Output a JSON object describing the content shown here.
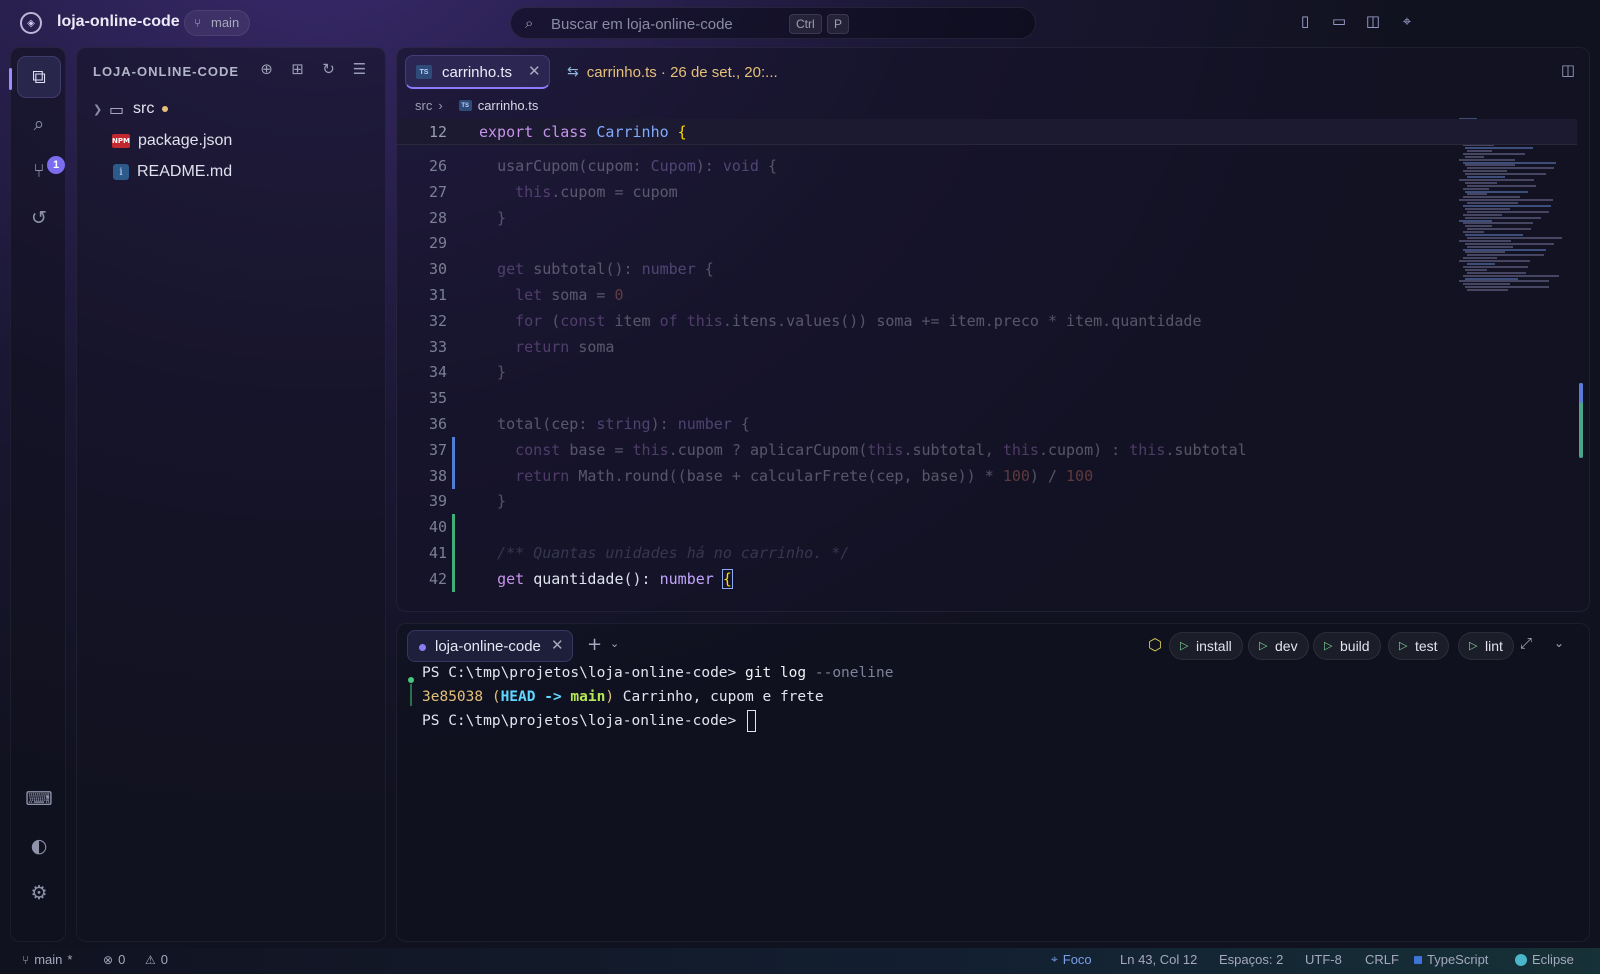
{
  "titlebar": {
    "project": "loja-online-code",
    "branch": "main",
    "search_placeholder": "Buscar em loja-online-code",
    "shortcut_ctrl": "Ctrl",
    "shortcut_p": "P"
  },
  "activity": {
    "scm_badge": "1"
  },
  "explorer": {
    "title": "LOJA-ONLINE-CODE",
    "items": [
      {
        "name": "src",
        "type": "folder",
        "modified": true
      },
      {
        "name": "package.json",
        "type": "npm"
      },
      {
        "name": "README.md",
        "type": "info"
      }
    ]
  },
  "editor": {
    "tab_label": "carrinho.ts",
    "tab_icon": "TS",
    "diff_tab_label": "carrinho.ts · 26 de set., 20:...",
    "breadcrumb_folder": "src",
    "breadcrumb_file": "carrinho.ts",
    "sticky_line": {
      "num": "12",
      "code": "export class Carrinho {"
    },
    "lines": [
      {
        "num": "26",
        "code": "  usarCupom(cupom: Cupom): void {"
      },
      {
        "num": "27",
        "code": "    this.cupom = cupom"
      },
      {
        "num": "28",
        "code": "  }"
      },
      {
        "num": "29",
        "code": ""
      },
      {
        "num": "30",
        "code": "  get subtotal(): number {"
      },
      {
        "num": "31",
        "code": "    let soma = 0"
      },
      {
        "num": "32",
        "code": "    for (const item of this.itens.values()) soma += item.preco * item.quantidade"
      },
      {
        "num": "33",
        "code": "    return soma"
      },
      {
        "num": "34",
        "code": "  }"
      },
      {
        "num": "35",
        "code": ""
      },
      {
        "num": "36",
        "code": "  total(cep: string): number {"
      },
      {
        "num": "37",
        "code": "    const base = this.cupom ? aplicarCupom(this.subtotal, this.cupom) : this.subtotal"
      },
      {
        "num": "38",
        "code": "    return Math.round((base + calcularFrete(cep, base)) * 100) / 100"
      },
      {
        "num": "39",
        "code": "  }"
      },
      {
        "num": "40",
        "code": ""
      },
      {
        "num": "41",
        "code": "  /** Quantas unidades há no carrinho. */"
      },
      {
        "num": "42",
        "code": "  get quantidade(): number {"
      }
    ]
  },
  "terminal": {
    "tab_label": "loja-online-code",
    "tasks": [
      "install",
      "dev",
      "build",
      "test",
      "lint"
    ],
    "prompt": "PS C:\\tmp\\projetos\\loja-online-code> ",
    "cmd": "git log",
    "cmd_flag": " --oneline",
    "log_hash": "3e85038",
    "log_head": "HEAD",
    "log_arrow": " -> ",
    "log_branch": "main",
    "log_msg": " Carrinho, cupom e frete"
  },
  "statusbar": {
    "branch": "main",
    "branch_dirty": "*",
    "errors": "0",
    "warnings": "0",
    "focus": "Foco",
    "position": "Ln 43, Col 12",
    "spaces": "Espaços: 2",
    "encoding": "UTF-8",
    "eol": "CRLF",
    "language": "TypeScript",
    "theme": "Eclipse"
  },
  "colors": {
    "accent": "#8a7bff",
    "added_gutter": "#3fae78",
    "modified_gutter": "#4e7fd6",
    "folder_modified_dot": "#e5c07b"
  }
}
